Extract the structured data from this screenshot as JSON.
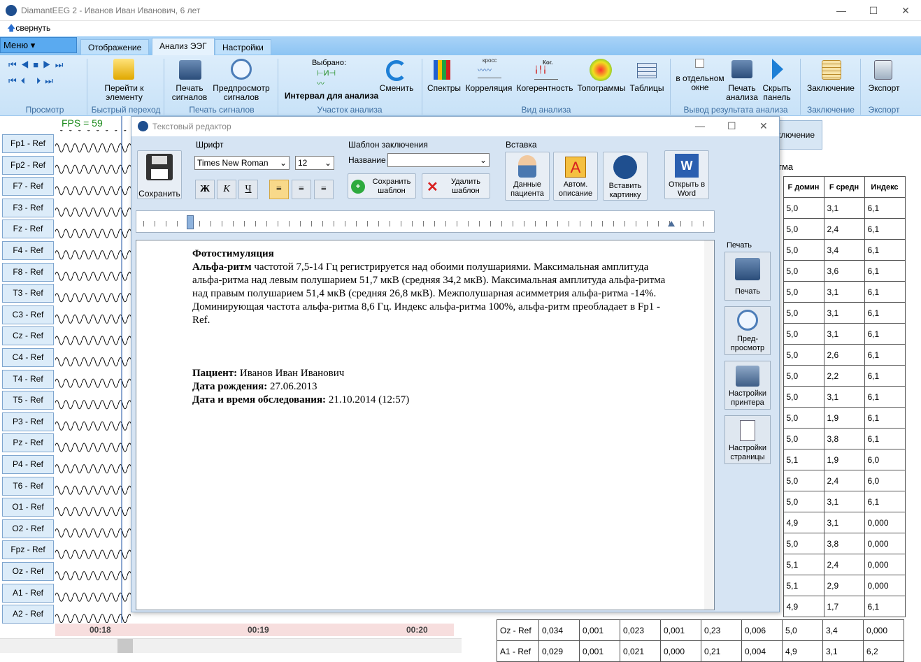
{
  "window": {
    "title": "DiamantEEG 2 - Иванов  Иван Иванович, 6 лет",
    "collapse": "свернуть"
  },
  "menu": {
    "label": "Меню"
  },
  "tabs": [
    "Отображение",
    "Анализ ЭЭГ",
    "Настройки"
  ],
  "ribbon": {
    "goto_label": "Перейти к элементу",
    "print_signals": "Печать сигналов",
    "preview_signals": "Предпросмотр сигналов",
    "selected": "Выбрано:",
    "interval": "Интервал для анализа",
    "change": "Сменить",
    "spectra": "Спектры",
    "correlation": "Корреляция",
    "coherence": "Когерентность",
    "topograms": "Топограммы",
    "tables": "Таблицы",
    "separate_window": "в отдельном окне",
    "print_analysis": "Печать анализа",
    "hide_panel": "Скрыть панель",
    "conclusion": "Заключение",
    "export": "Экспорт",
    "cross_tag": "кросс",
    "coh_tag": "Ког.",
    "groups": [
      "Просмотр",
      "Быстрый переход",
      "Печать сигналов",
      "Участок анализа",
      "Вид анализа",
      "Вывод результата анализа",
      "Заключение",
      "Экспорт"
    ]
  },
  "eeg": {
    "fps": "FPS = 59",
    "channels": [
      "Fp1 - Ref",
      "Fp2 - Ref",
      "F7 - Ref",
      "F3 - Ref",
      "Fz - Ref",
      "F4 - Ref",
      "F8 - Ref",
      "T3 - Ref",
      "C3 - Ref",
      "Cz - Ref",
      "C4 - Ref",
      "T4 - Ref",
      "T5 - Ref",
      "P3 - Ref",
      "Pz - Ref",
      "P4 - Ref",
      "T6 - Ref",
      "O1 - Ref",
      "O2 - Ref",
      "Fpz - Ref",
      "Oz - Ref",
      "A1 - Ref",
      "A2 - Ref"
    ],
    "times": [
      "00:18",
      "00:19",
      "00:20"
    ]
  },
  "right": {
    "conclusion_btn": "ключение",
    "rhythm": "тма",
    "headers": [
      "F домин",
      "F средн",
      "Индекс"
    ],
    "rows": [
      [
        "5,0",
        "3,1",
        "6,1"
      ],
      [
        "5,0",
        "2,4",
        "6,1"
      ],
      [
        "5,0",
        "3,4",
        "6,1"
      ],
      [
        "5,0",
        "3,6",
        "6,1"
      ],
      [
        "5,0",
        "3,1",
        "6,1"
      ],
      [
        "5,0",
        "3,1",
        "6,1"
      ],
      [
        "5,0",
        "3,1",
        "6,1"
      ],
      [
        "5,0",
        "2,6",
        "6,1"
      ],
      [
        "5,0",
        "2,2",
        "6,1"
      ],
      [
        "5,0",
        "3,1",
        "6,1"
      ],
      [
        "5,0",
        "1,9",
        "6,1"
      ],
      [
        "5,0",
        "3,8",
        "6,1"
      ],
      [
        "5,1",
        "1,9",
        "6,0"
      ],
      [
        "5,0",
        "2,4",
        "6,0"
      ],
      [
        "5,0",
        "3,1",
        "6,1"
      ],
      [
        "4,9",
        "3,1",
        "0,000"
      ],
      [
        "5,0",
        "3,8",
        "0,000"
      ],
      [
        "5,1",
        "2,4",
        "0,000"
      ],
      [
        "5,1",
        "2,9",
        "0,000"
      ],
      [
        "4,9",
        "1,7",
        "6,1"
      ]
    ],
    "oz_row": [
      "Oz - Ref",
      "0,034",
      "0,001",
      "0,023",
      "0,001",
      "0,23",
      "0,006",
      "5,0",
      "3,4",
      "0,000"
    ],
    "a1_row": [
      "A1 - Ref",
      "0,029",
      "0,001",
      "0,021",
      "0,000",
      "0,21",
      "0,004",
      "4,9",
      "3,1",
      "6,2"
    ]
  },
  "dialog": {
    "title": "Текстовый редактор",
    "save": "Сохранить",
    "font_group": "Шрифт",
    "font_name": "Times New Roman",
    "font_size": "12",
    "bold": "Ж",
    "italic": "К",
    "underline": "Ч",
    "template_group": "Шаблон заключения",
    "name_label": "Название",
    "save_template": "Сохранить шаблон",
    "delete_template": "Удалить шаблон",
    "insert_group": "Вставка",
    "patient_data": "Данные пациента",
    "auto_desc": "Автом. описание",
    "insert_picture": "Вставить картинку",
    "open_word": "Открыть в Word",
    "print_group": "Печать",
    "print": "Печать",
    "preview": "Пред-просмотр",
    "printer_settings": "Настройки принтера",
    "page_settings": "Настройки страницы",
    "doc": {
      "heading": "Фотостимуляция",
      "alpha_bold": "Альфа-ритм",
      "alpha_text": " частотой 7,5-14 Гц регистрируется над обоими полушариями. Максимальная амплитуда альфа-ритма над левым полушарием 51,7 мкВ (средняя 34,2 мкВ). Максимальная амплитуда альфа-ритма над правым полушарием 51,4 мкВ (средняя 26,8 мкВ). Межполушарная асимметрия альфа-ритма -14%. Доминирующая частота альфа-ритма 8,6 Гц. Индекс альфа-ритма 100%, альфа-ритм преобладает в Fp1 - Ref.",
      "patient_label": "Пациент:",
      "patient": " Иванов  Иван Иванович",
      "dob_label": "Дата рождения:",
      "dob": " 27.06.2013",
      "exam_label": "Дата и время обследования:",
      "exam": " 21.10.2014 (12:57)"
    }
  }
}
